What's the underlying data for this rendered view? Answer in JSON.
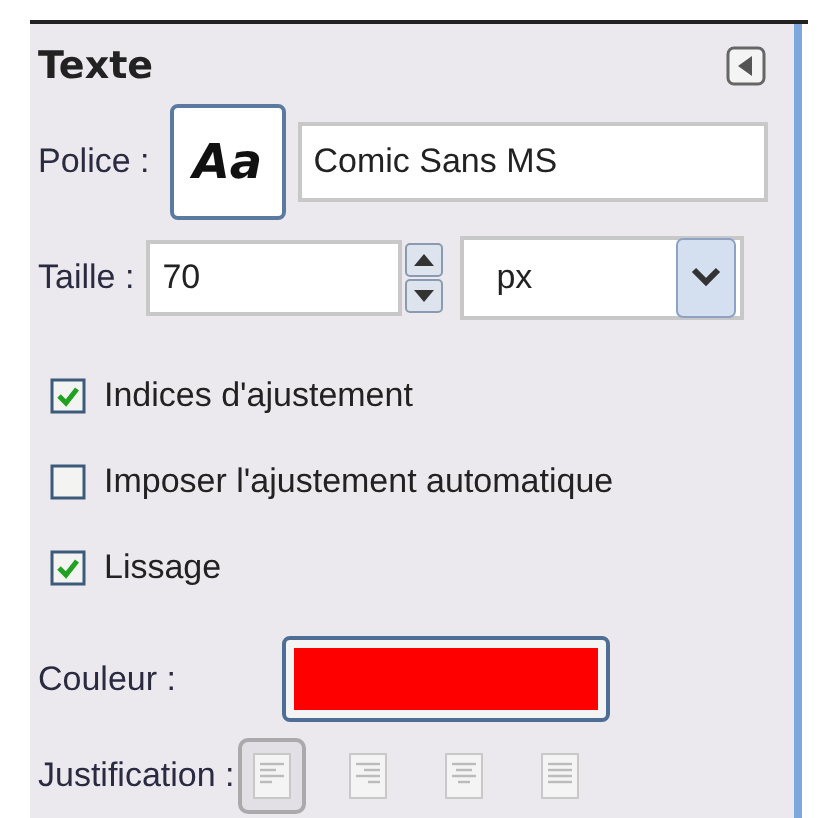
{
  "panel": {
    "title": "Texte"
  },
  "font": {
    "label": "Police :",
    "button": "Aa",
    "value": "Comic Sans MS"
  },
  "size": {
    "label": "Taille :",
    "value": "70",
    "unit": "px"
  },
  "options": [
    {
      "label": "Indices d'ajustement",
      "checked": true
    },
    {
      "label": "Imposer l'ajustement automatique",
      "checked": false
    },
    {
      "label": "Lissage",
      "checked": true
    }
  ],
  "color": {
    "label": "Couleur :",
    "color": "#ff0000"
  },
  "justification": {
    "label": "Justification :",
    "buttons": [
      {
        "kind": "left",
        "selected": true
      },
      {
        "kind": "right",
        "selected": false
      },
      {
        "kind": "center",
        "selected": false
      },
      {
        "kind": "fill",
        "selected": false
      }
    ]
  }
}
